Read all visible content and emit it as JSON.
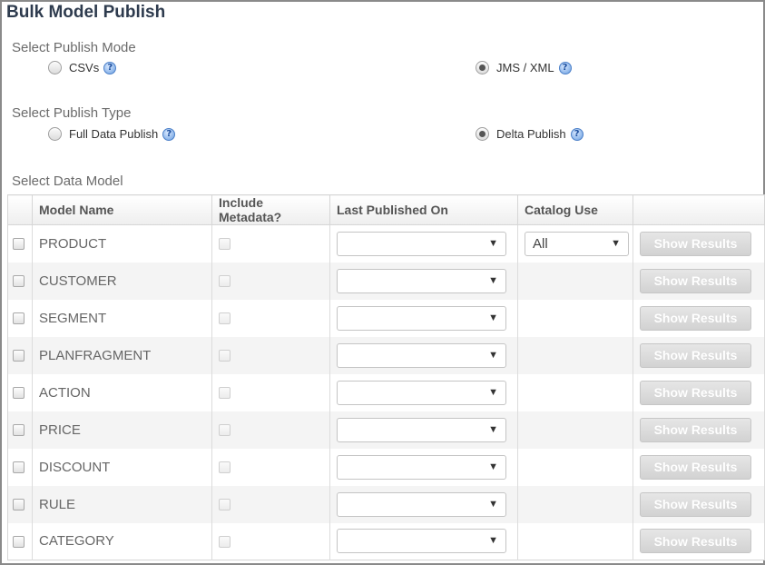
{
  "title": "Bulk Model Publish",
  "publish_mode": {
    "label": "Select Publish Mode",
    "options": [
      {
        "label": "CSVs",
        "checked": false
      },
      {
        "label": "JMS / XML",
        "checked": true
      }
    ]
  },
  "publish_type": {
    "label": "Select Publish Type",
    "options": [
      {
        "label": "Full Data Publish",
        "checked": false
      },
      {
        "label": "Delta Publish",
        "checked": true
      }
    ]
  },
  "data_model": {
    "label": "Select Data Model",
    "columns": [
      "",
      "Model Name",
      "Include Metadata?",
      "Last Published On",
      "Catalog Use",
      ""
    ],
    "rows": [
      {
        "name": "PRODUCT",
        "last_published": "",
        "catalog_use": "All",
        "action": "Show Results"
      },
      {
        "name": "CUSTOMER",
        "last_published": "",
        "catalog_use": "",
        "action": "Show Results"
      },
      {
        "name": "SEGMENT",
        "last_published": "",
        "catalog_use": "",
        "action": "Show Results"
      },
      {
        "name": "PLANFRAGMENT",
        "last_published": "",
        "catalog_use": "",
        "action": "Show Results"
      },
      {
        "name": "ACTION",
        "last_published": "",
        "catalog_use": "",
        "action": "Show Results"
      },
      {
        "name": "PRICE",
        "last_published": "",
        "catalog_use": "",
        "action": "Show Results"
      },
      {
        "name": "DISCOUNT",
        "last_published": "",
        "catalog_use": "",
        "action": "Show Results"
      },
      {
        "name": "RULE",
        "last_published": "",
        "catalog_use": "",
        "action": "Show Results"
      },
      {
        "name": "CATEGORY",
        "last_published": "",
        "catalog_use": "",
        "action": "Show Results"
      }
    ]
  },
  "icons": {
    "help": "help-icon",
    "dropdown": "chevron-down-icon"
  },
  "help_glyph": "?",
  "dropdown_glyph": "▼"
}
